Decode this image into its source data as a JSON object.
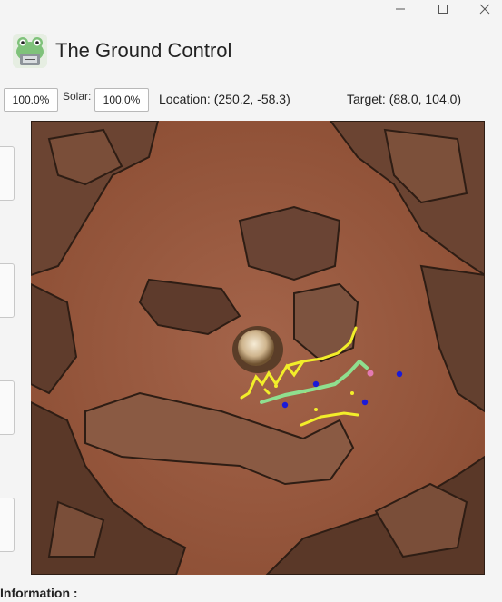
{
  "window": {
    "controls": [
      {
        "name": "minimize-icon"
      },
      {
        "name": "maximize-icon"
      },
      {
        "name": "close-icon"
      }
    ]
  },
  "app": {
    "title": "The Ground Control",
    "logo_icon": "frog-robot-icon"
  },
  "status": {
    "battery_value": "100.0%",
    "solar_label": "Solar:",
    "solar_value": "100.0%",
    "location_text": "Location: (250.2, -58.3)",
    "target_text": "Target: (88.0, 104.0)"
  },
  "info": {
    "label": "Information :"
  },
  "colors": {
    "path_green": "#8fdf8f",
    "hazard_yellow": "#f2ee2a",
    "waypoint_blue": "#1a1ad8",
    "rover_pink": "#e37ab2",
    "terrain": "#9a5a3c"
  }
}
